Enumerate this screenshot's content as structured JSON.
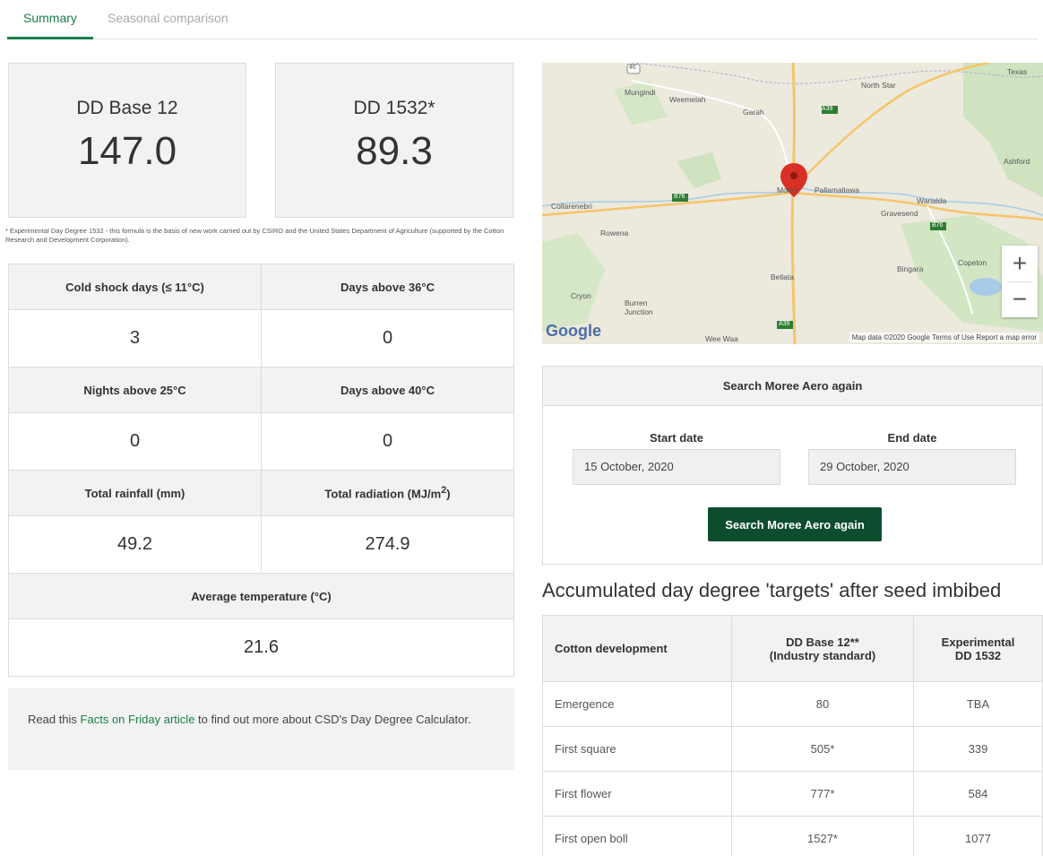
{
  "tabs": [
    {
      "label": "Summary",
      "active": true
    },
    {
      "label": "Seasonal comparison",
      "active": false
    }
  ],
  "cards": [
    {
      "label": "DD Base 12",
      "value": "147.0"
    },
    {
      "label": "DD 1532*",
      "value": "89.3"
    }
  ],
  "footnote": "* Experimental Day Degree 1532 - this formula is the basis of new work carried out by CSIRO and the United States Department of Agriculture (supported by the Cotton Research and Development Corporation).",
  "stats": {
    "cold_shock_label": "Cold shock days (≤ 11°C)",
    "cold_shock_value": "3",
    "days_above_36_label": "Days above 36°C",
    "days_above_36_value": "0",
    "nights_above_25_label": "Nights above 25°C",
    "nights_above_25_value": "0",
    "days_above_40_label": "Days above 40°C",
    "days_above_40_value": "0",
    "rainfall_label": "Total rainfall (mm)",
    "rainfall_value": "49.2",
    "radiation_label": "Total radiation (MJ/m",
    "radiation_sup": "2",
    "radiation_close": ")",
    "radiation_value": "274.9",
    "avg_temp_label": "Average temperature (°C)",
    "avg_temp_value": "21.6"
  },
  "readmore": {
    "before": "Read this ",
    "link": "Facts on Friday article",
    "after": " to find out more about CSD's Day Degree Calculator."
  },
  "map": {
    "labels": {
      "mungindi": "Mungindi",
      "weemelah": "Weemelah",
      "garah": "Garah",
      "north_star": "North Star",
      "texas": "Texas",
      "ashford": "Ashford",
      "collarenebri": "Collarenebri",
      "moree": "Moree",
      "pallamallawa": "Pallamallawa",
      "warialda": "Warialda",
      "gravesend": "Gravesend",
      "rowena": "Rowena",
      "bellata": "Bellata",
      "bingara": "Bingara",
      "copeton": "Copeton",
      "cryon": "Cryon",
      "burren_junction": "Burren Junction",
      "wee_waa": "Wee Waa"
    },
    "route_labels": [
      "46",
      "A39",
      "B76",
      "B76",
      "A39"
    ],
    "google_logo": "Google",
    "credit": "Map data ©2020 Google   Terms of Use   Report a map error",
    "zoom_in": "+",
    "zoom_out": "−"
  },
  "search": {
    "title": "Search Moree Aero again",
    "start_label": "Start date",
    "start_value": "15 October, 2020",
    "end_label": "End date",
    "end_value": "29 October, 2020",
    "button": "Search Moree Aero again"
  },
  "targets": {
    "title": "Accumulated day degree 'targets' after seed imbibed",
    "headers": [
      "Cotton development",
      "DD Base 12**",
      "(Industry standard)",
      "Experimental",
      "DD 1532"
    ],
    "rows": [
      {
        "stage": "Emergence",
        "base12": "80",
        "dd1532": "TBA"
      },
      {
        "stage": "First square",
        "base12": "505*",
        "dd1532": "339"
      },
      {
        "stage": "First flower",
        "base12": "777*",
        "dd1532": "584"
      },
      {
        "stage": "First open boll",
        "base12": "1527*",
        "dd1532": "1077"
      }
    ]
  },
  "colors": {
    "accent": "#1a7f4b",
    "button": "#0d4d2e",
    "panel": "#f2f2f2"
  }
}
